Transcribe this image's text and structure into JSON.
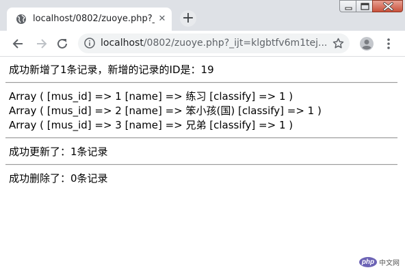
{
  "browser": {
    "tab": {
      "title": "localhost/0802/zuoye.php?_ijt",
      "favicon": "globe-icon",
      "close_label": "✕"
    },
    "new_tab_label": "+",
    "window_controls": [
      "minimize",
      "maximize",
      "close"
    ]
  },
  "toolbar": {
    "url_host": "localhost",
    "url_rest": "/0802/zuoye.php?_ijt=klgbtfv6m1tej...",
    "icons": [
      "back-icon",
      "forward-icon",
      "reload-icon",
      "info-icon",
      "star-icon",
      "profile-icon",
      "menu-icon"
    ]
  },
  "page": {
    "insert_message": "成功新增了1条记录，新增的记录的ID是：19",
    "rows": [
      "Array ( [mus_id] => 1 [name] => 练习 [classify] => 1 )",
      "Array ( [mus_id] => 2 [name] => 笨小孩(国) [classify] => 1 )",
      "Array ( [mus_id] => 3 [name] => 兄弟 [classify] => 1 )"
    ],
    "update_message": "成功更新了：1条记录",
    "delete_message": "成功删除了：0条记录"
  },
  "watermark": {
    "logo_text": "php",
    "site_text": "中文网"
  },
  "colors": {
    "tabstrip": "#dee1e6",
    "omnibox": "#f1f3f4",
    "watermark_logo": "#6c63b5"
  }
}
